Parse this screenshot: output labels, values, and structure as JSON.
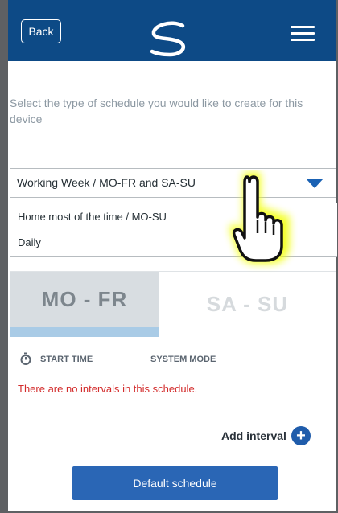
{
  "header": {
    "back_label": "Back",
    "brand_color": "#0d4a86"
  },
  "instructions": "Select the type of schedule you would like to create for this device",
  "schedule_select": {
    "selected": "Working Week / MO-FR and SA-SU",
    "options": [
      "Home most of the time / MO-SU",
      "Daily"
    ]
  },
  "tabs": [
    {
      "label": "MO - FR",
      "active": true
    },
    {
      "label": "SA - SU",
      "active": false
    }
  ],
  "columns": {
    "start_time": "START TIME",
    "system_mode": "SYSTEM MODE"
  },
  "empty_message": "There are no intervals in this schedule.",
  "add_interval_label": "Add interval",
  "default_button": "Default schedule",
  "colors": {
    "accent": "#1f5cab",
    "error": "#d32c2c",
    "tab_indicator": "#a9cbe6"
  },
  "icons": [
    "logo-icon",
    "menu-icon",
    "caret-down-icon",
    "stopwatch-icon",
    "plus-icon",
    "hand-pointer-icon"
  ]
}
